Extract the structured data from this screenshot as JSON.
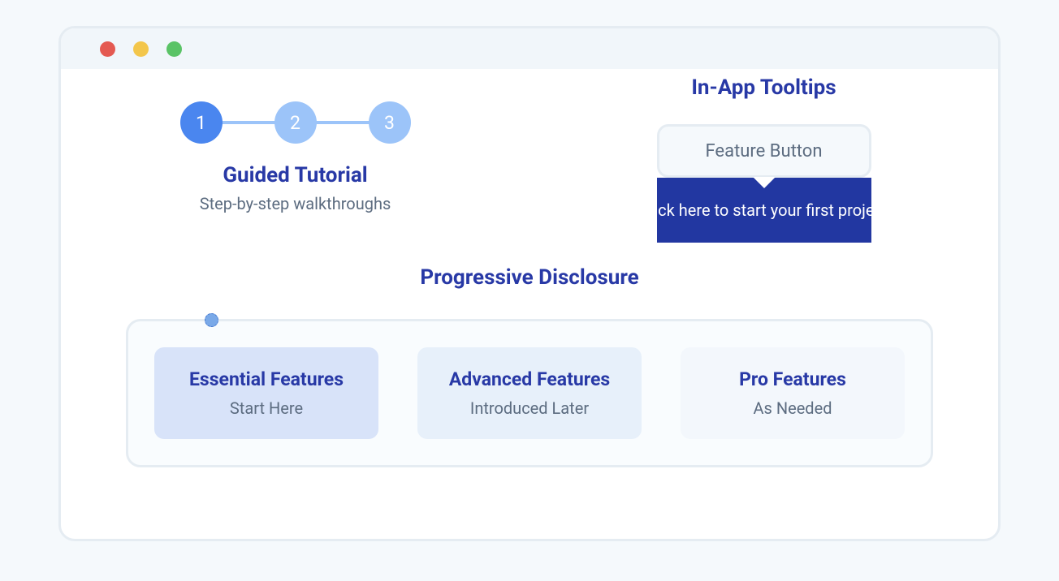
{
  "guided": {
    "steps": [
      "1",
      "2",
      "3"
    ],
    "title": "Guided Tutorial",
    "subtitle": "Step-by-step walkthroughs"
  },
  "tooltips": {
    "title": "In-App Tooltips",
    "button_label": "Feature Button",
    "tooltip_text": "Click here to start your first project"
  },
  "progressive": {
    "title": "Progressive Disclosure",
    "cards": [
      {
        "title": "Essential Features",
        "sub": "Start Here"
      },
      {
        "title": "Advanced Features",
        "sub": "Introduced Later"
      },
      {
        "title": "Pro Features",
        "sub": "As Needed"
      }
    ]
  }
}
